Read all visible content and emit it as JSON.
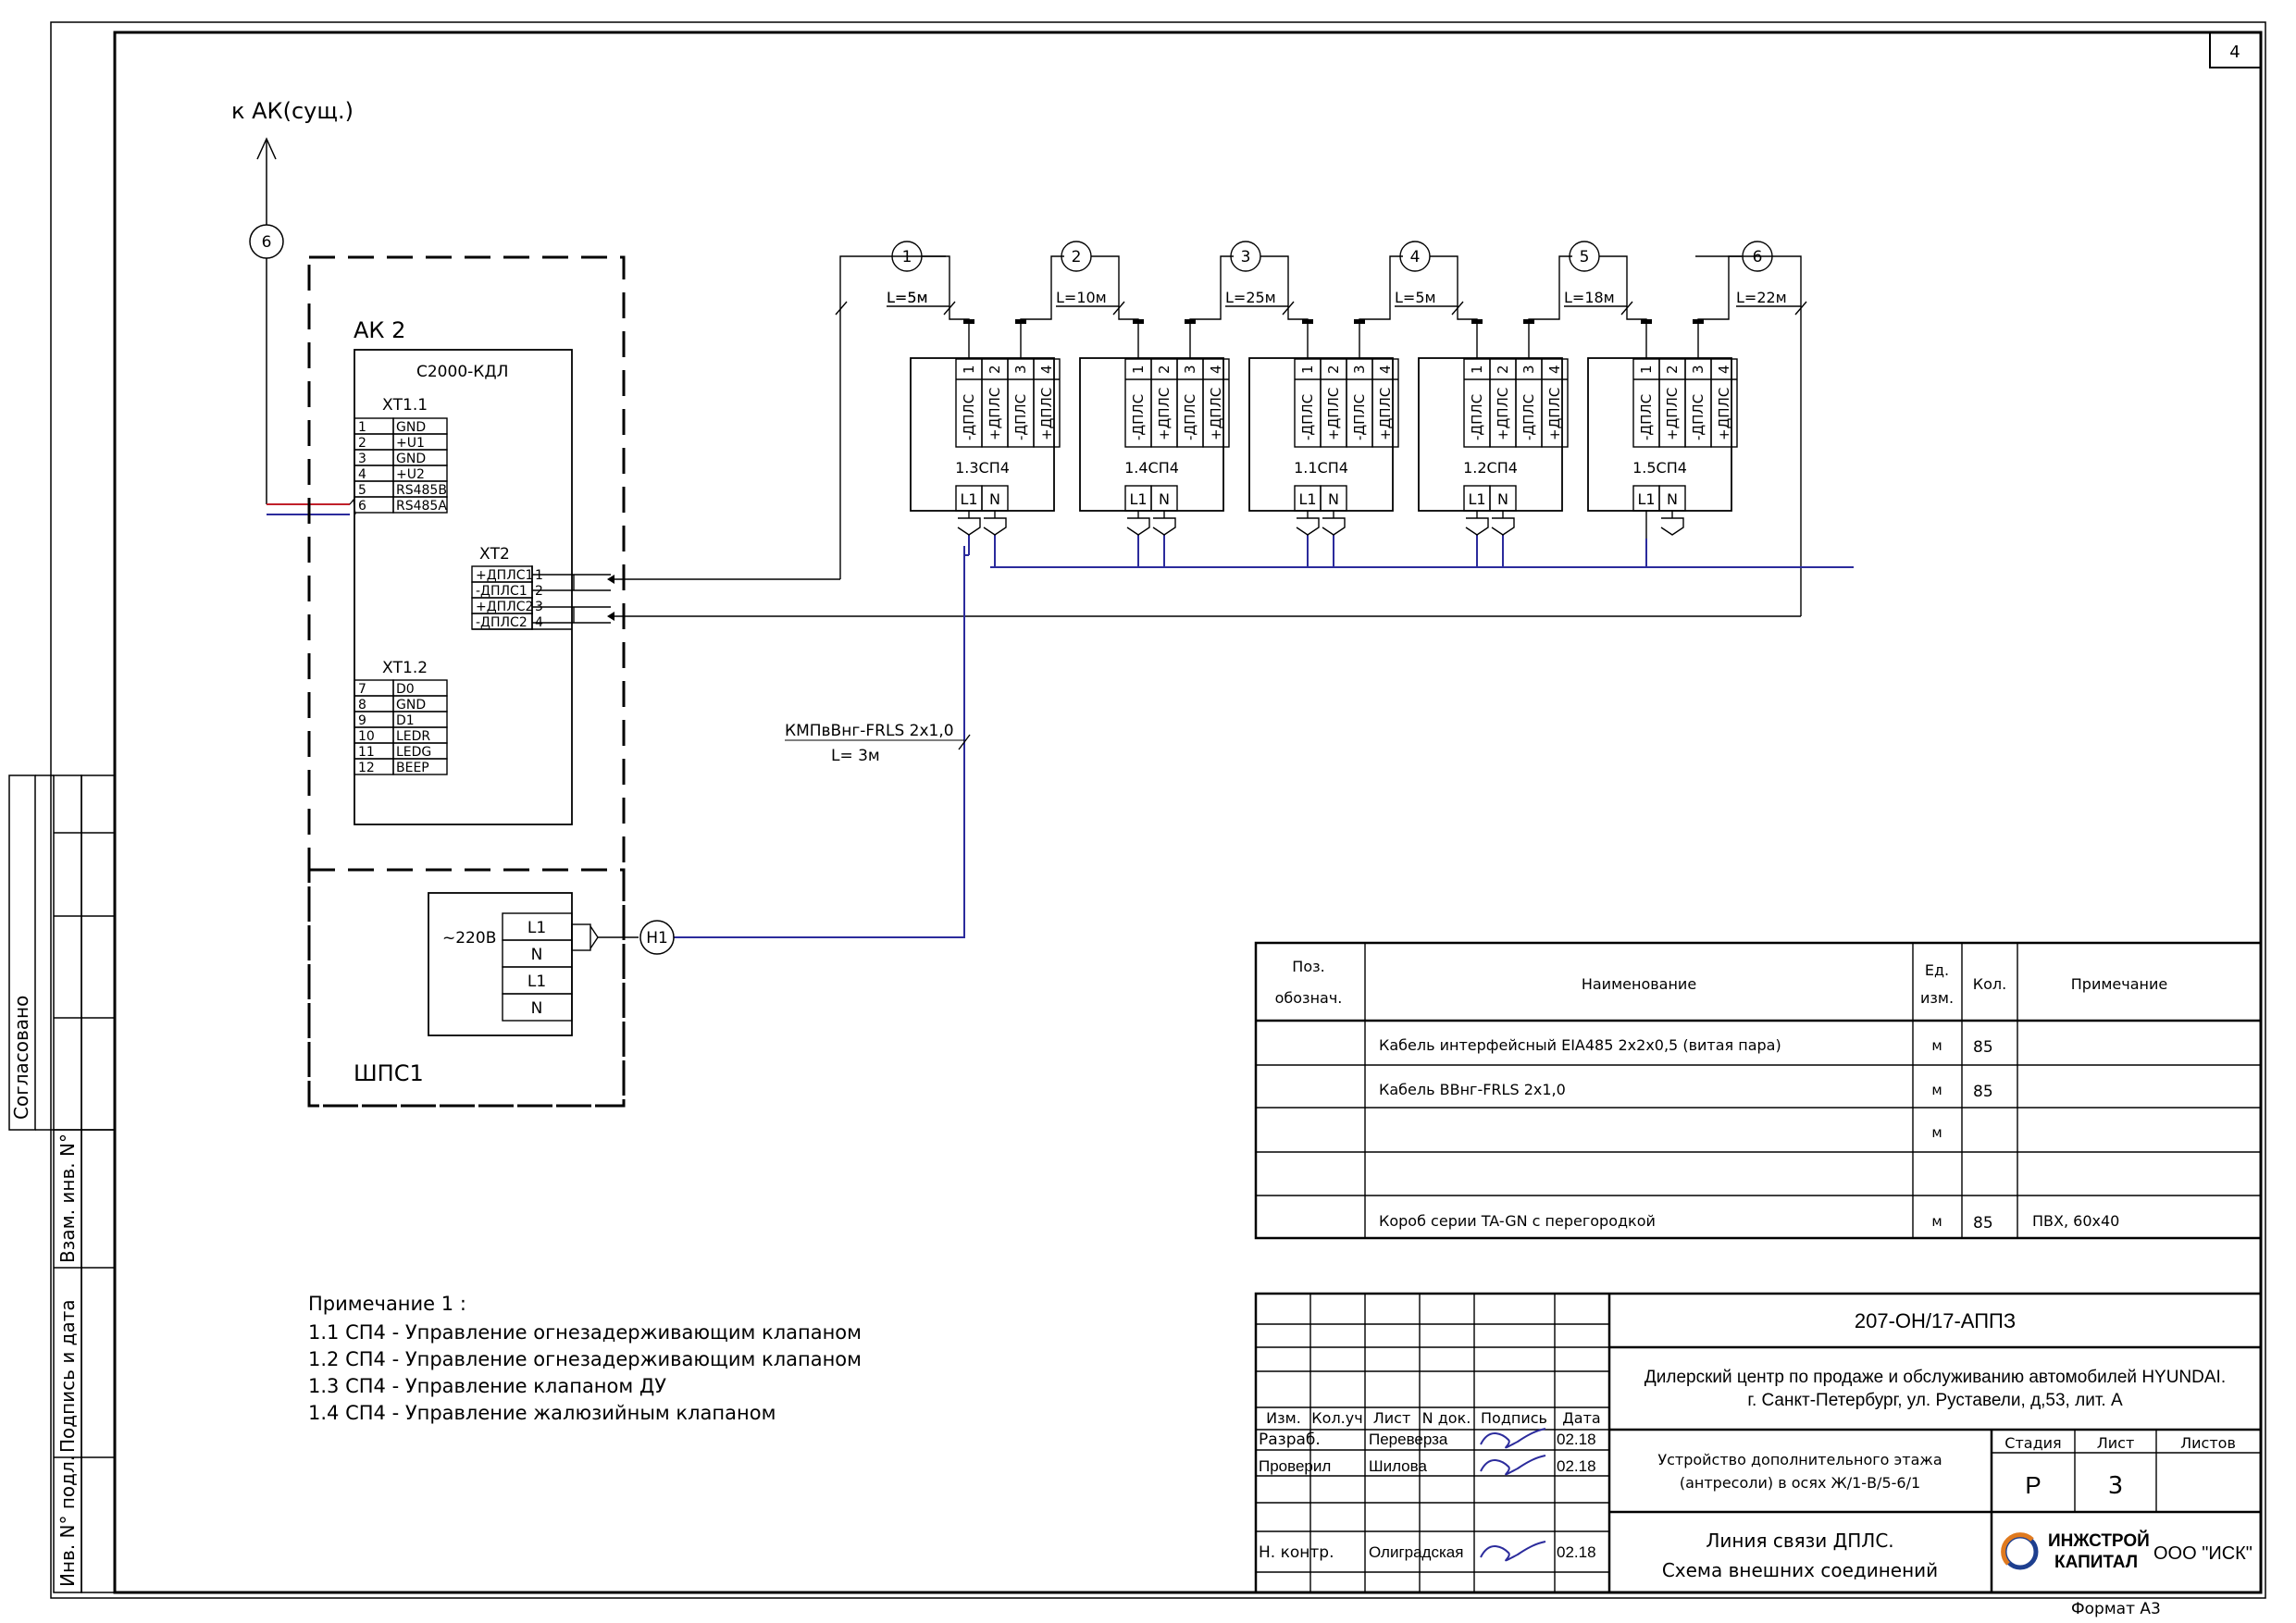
{
  "sheet_number": "4",
  "format_label": "Формат А3",
  "ext_link": {
    "label": "к АК(сущ.)",
    "marker": "6"
  },
  "ak": {
    "title": "АК 2",
    "device": "С2000-КДЛ",
    "xt11": {
      "title": "ХТ1.1",
      "rows": [
        [
          "1",
          "GND"
        ],
        [
          "2",
          "+U1"
        ],
        [
          "3",
          "GND"
        ],
        [
          "4",
          "+U2"
        ],
        [
          "5",
          "RS485B"
        ],
        [
          "6",
          "RS485A"
        ]
      ]
    },
    "xt2": {
      "title": "ХТ2",
      "rows": [
        [
          "+ДПЛС1",
          "1"
        ],
        [
          "-ДПЛС1",
          "2"
        ],
        [
          "+ДПЛС2",
          "3"
        ],
        [
          "-ДПЛС2",
          "4"
        ]
      ]
    },
    "xt12": {
      "title": "ХТ1.2",
      "rows": [
        [
          "7",
          "D0"
        ],
        [
          "8",
          "GND"
        ],
        [
          "9",
          "D1"
        ],
        [
          "10",
          "LEDR"
        ],
        [
          "11",
          "LEDG"
        ],
        [
          "12",
          "BEEP"
        ]
      ]
    }
  },
  "shps": {
    "title": "ШПС1",
    "voltage": "~220В",
    "terminals": [
      "L1",
      "N",
      "L1",
      "N"
    ],
    "marker": "Н1"
  },
  "cable": {
    "name": "КМПвВнг-FRLS 2х1,0",
    "length": "L= 3м"
  },
  "modules": [
    {
      "label": "1.3СП4",
      "marker": "1",
      "length": "L=5м"
    },
    {
      "label": "1.4СП4",
      "marker": "2",
      "length": "L=10м"
    },
    {
      "label": "1.1СП4",
      "marker": "3",
      "length": "L=25м"
    },
    {
      "label": "1.2СП4",
      "marker": "4",
      "length": "L=5м"
    },
    {
      "label": "1.5СП4",
      "marker": "5",
      "length": "L=18м"
    }
  ],
  "last_marker": {
    "marker": "6",
    "length": "L=22м"
  },
  "module_terms": [
    {
      "num": "1",
      "name": "-ДПЛС"
    },
    {
      "num": "2",
      "name": "+ДПЛС"
    },
    {
      "num": "3",
      "name": "-ДПЛС"
    },
    {
      "num": "4",
      "name": "+ДПЛС"
    }
  ],
  "power_terms": [
    "L1",
    "N"
  ],
  "notes": {
    "title": "Примечание 1 :",
    "items": [
      "1.1 СП4 - Управление огнезадерживающим клапаном",
      "1.2 СП4 - Управление огнезадерживающим клапаном",
      "1.3 СП4 - Управление клапаном ДУ",
      "1.4 СП4 - Управление жалюзийным клапаном"
    ]
  },
  "spec": {
    "headers": {
      "pos1": "Поз.",
      "pos2": "обознач.",
      "name": "Наименование",
      "unit1": "Ед.",
      "unit2": "изм.",
      "qty": "Кол.",
      "note": "Примечание"
    },
    "rows": [
      {
        "pos": "",
        "name": "Кабель интерфейсный EIA485 2х2х0,5 (витая пара)",
        "unit": "м",
        "qty": "85",
        "note": ""
      },
      {
        "pos": "",
        "name": "Кабель ВВнг-FRLS 2х1,0",
        "unit": "м",
        "qty": "85",
        "note": ""
      },
      {
        "pos": "",
        "name": "",
        "unit": "м",
        "qty": "",
        "note": ""
      },
      {
        "pos": "",
        "name": "",
        "unit": "",
        "qty": "",
        "note": ""
      },
      {
        "pos": "",
        "name": "Короб серии TA-GN с перегородкой",
        "unit": "м",
        "qty": "85",
        "note": "ПВХ, 60х40"
      }
    ]
  },
  "titleblock": {
    "code": "207-ОН/17-АППЗ",
    "project_line1": "Дилерский центр по продаже и обслуживанию автомобилей HYUNDAI.",
    "project_line2": "г. Санкт-Петербург, ул. Руставели, д,53, лит. А",
    "object_line1": "Устройство дополнительного этажа",
    "object_line2": "(антресоли) в осях Ж/1-В/5-6/1",
    "sheet_title1": "Линия связи ДПЛС.",
    "sheet_title2": "Схема внешних соединений",
    "col_headers": [
      "Изм.",
      "Кол.уч",
      "Лист",
      "N док.",
      "Подпись",
      "Дата"
    ],
    "people": [
      {
        "role": "Разраб.",
        "name": "Переверза",
        "date": "02.18"
      },
      {
        "role": "Проверил",
        "name": "Шилова",
        "date": "02.18"
      },
      {
        "role": "Н. контр.",
        "name": "Олиградская",
        "date": "02.18"
      }
    ],
    "stage_header": "Стадия",
    "sheet_header": "Лист",
    "sheets_header": "Листов",
    "stage": "Р",
    "sheet": "3",
    "sheets": "",
    "logo_top": "ИНЖСТРОЙ",
    "logo_bottom": "КАПИТАЛ",
    "company": "ООО \"ИСК\""
  },
  "side_labels": {
    "agreed": "Согласовано",
    "swap": "Взам. инв. N°",
    "sign_date": "Подпись и дата",
    "inv": "Инв. N° подл."
  },
  "colors": {
    "wire_blue": "#2b2b9c",
    "wire_red": "#c0202a",
    "logo_blue": "#1e3f8f",
    "logo_orange": "#e07a1f"
  }
}
